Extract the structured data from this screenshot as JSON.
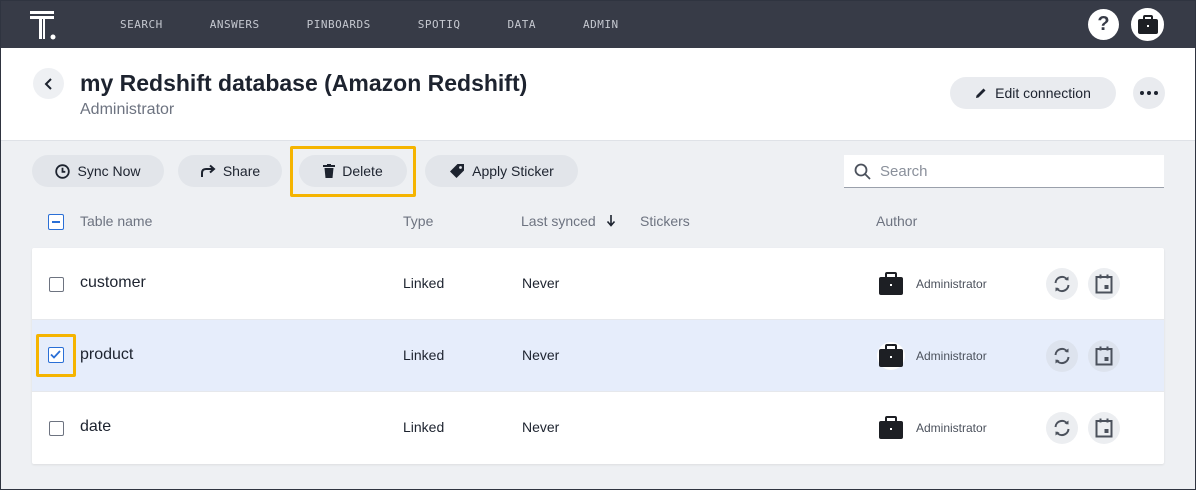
{
  "nav": {
    "items": [
      "SEARCH",
      "ANSWERS",
      "PINBOARDS",
      "SPOTIQ",
      "DATA",
      "ADMIN"
    ],
    "help_label": "?"
  },
  "header": {
    "title": "my Redshift database (Amazon Redshift)",
    "subtitle": "Administrator",
    "edit_label": "Edit connection"
  },
  "toolbar": {
    "sync_label": "Sync Now",
    "share_label": "Share",
    "delete_label": "Delete",
    "sticker_label": "Apply Sticker",
    "search_placeholder": "Search"
  },
  "table": {
    "columns": {
      "name": "Table name",
      "type": "Type",
      "last_synced": "Last synced",
      "stickers": "Stickers",
      "author": "Author"
    },
    "rows": [
      {
        "name": "customer",
        "type": "Linked",
        "last_synced": "Never",
        "author": "Administrator",
        "checked": false
      },
      {
        "name": "product",
        "type": "Linked",
        "last_synced": "Never",
        "author": "Administrator",
        "checked": true
      },
      {
        "name": "date",
        "type": "Linked",
        "last_synced": "Never",
        "author": "Administrator",
        "checked": false
      }
    ]
  },
  "colors": {
    "nav_bg": "#373b47",
    "highlight": "#f5b400",
    "accent": "#2a6fd6",
    "selected_row": "#e6edfb"
  }
}
